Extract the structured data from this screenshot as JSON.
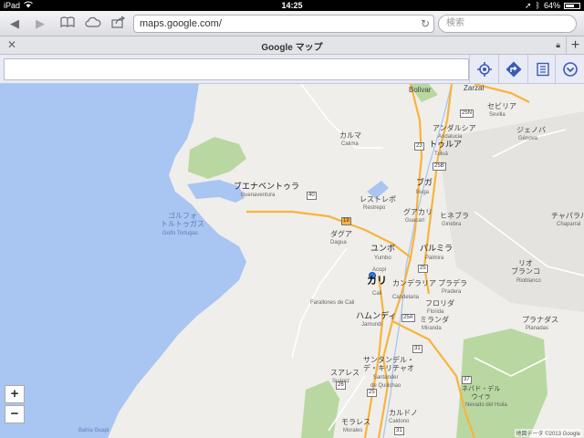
{
  "status": {
    "device": "iPad",
    "time": "14:25",
    "battery": "64%",
    "battery_level": 0.64
  },
  "toolbar": {
    "url": "maps.google.com/",
    "search_placeholder": "検索"
  },
  "tab": {
    "title": "Google マップ"
  },
  "colors": {
    "land": "#efeeea",
    "water": "#a9c5f2",
    "park": "#b9d7a1",
    "road_major": "#f7b43c",
    "road_minor": "#ffffff"
  },
  "map": {
    "places": [
      {
        "ja": "ボリバル",
        "en": "Bolivar"
      },
      {
        "ja": "サルサル",
        "en": "Zarzal"
      },
      {
        "ja": "セビリア",
        "en": "Sevilla"
      },
      {
        "ja": "アンダルシア",
        "en": "Andalucia"
      },
      {
        "ja": "ジェノバ",
        "en": "Génova"
      },
      {
        "ja": "カルマ",
        "en": "Calima"
      },
      {
        "ja": "トゥルア",
        "en": "Tuluá"
      },
      {
        "ja": "ブエナベントゥラ",
        "en": "Buenaventura"
      },
      {
        "ja": "ブガ",
        "en": "Buga"
      },
      {
        "ja": "レストレポ",
        "en": "Restrepo"
      },
      {
        "ja": "グアカリ",
        "en": "Guacarí"
      },
      {
        "ja": "ヒネブラ",
        "en": "Ginebra"
      },
      {
        "ja": "チャパラル",
        "en": "Chaparral"
      },
      {
        "ja": "ゴルフォ\nトルトゥガス",
        "en": "Golfo Tortugas"
      },
      {
        "ja": "ダグア",
        "en": "Dagua"
      },
      {
        "ja": "ユンボ",
        "en": "Yumbo"
      },
      {
        "ja": "パルミラ",
        "en": "Palmira"
      },
      {
        "ja": "リオ\nブランコ",
        "en": "Rioblanco"
      },
      {
        "ja": "",
        "en": "Acopi"
      },
      {
        "ja": "カンデラリア",
        "en": "Candelaria"
      },
      {
        "ja": "プラデラ",
        "en": "Pradera"
      },
      {
        "ja": "",
        "en": "Farallones de Cali"
      },
      {
        "ja": "フロリダ",
        "en": "Florida"
      },
      {
        "ja": "ミランダ",
        "en": "Miranda"
      },
      {
        "ja": "プラナダス",
        "en": "Planadas"
      },
      {
        "ja": "ハムンディ",
        "en": "Jamundí"
      },
      {
        "ja": "サンタンデル・\nデ・キリチャオ",
        "en": "Santander\nde Quilichao"
      },
      {
        "ja": "スアレス",
        "en": "Suárez"
      },
      {
        "ja": "ネバド・デル\nウイラ",
        "en": "Nevado del Huila"
      },
      {
        "ja": "カルドノ",
        "en": "Caldono"
      },
      {
        "ja": "モラレス",
        "en": "Morales"
      },
      {
        "ja": "",
        "en": "Bahía Guapi"
      }
    ],
    "main_city": {
      "ja": "カリ",
      "en": "Cali"
    },
    "shields": [
      "25N",
      "23",
      "25B",
      "40",
      "19",
      "25",
      "25A",
      "31",
      "25",
      "37",
      "26",
      "31"
    ],
    "zoom_in": "+",
    "zoom_out": "−",
    "copyright": "地図データ ©2013 Google"
  }
}
